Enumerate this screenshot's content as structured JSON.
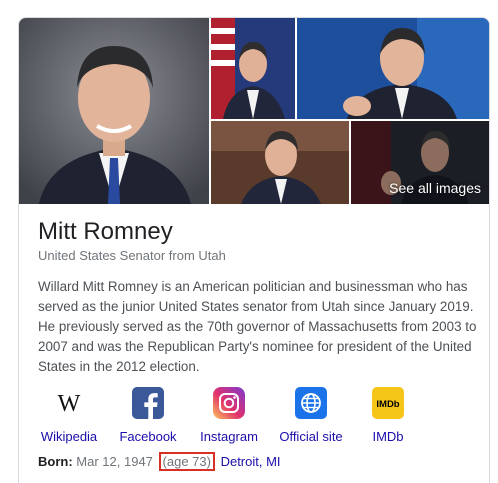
{
  "knowledge_panel": {
    "images": {
      "see_all_label": "See all images"
    },
    "name": "Mitt Romney",
    "subtitle": "United States Senator from Utah",
    "description": "Willard Mitt Romney is an American politician and businessman who has served as the junior United States senator from Utah since January 2019. He previously served as the 70th governor of Massachusetts from 2003 to 2007 and was the Republican Party's nominee for president of the United States in the 2012 election.",
    "profiles": [
      {
        "label": "Wikipedia",
        "icon": "wikipedia-icon",
        "color": "#ffffff"
      },
      {
        "label": "Facebook",
        "icon": "facebook-icon",
        "color": "#3b5998"
      },
      {
        "label": "Instagram",
        "icon": "instagram-icon",
        "color": "#c13584"
      },
      {
        "label": "Official site",
        "icon": "globe-icon",
        "color": "#1a73e8"
      },
      {
        "label": "IMDb",
        "icon": "imdb-icon",
        "color": "#f5c518"
      }
    ],
    "born": {
      "label": "Born:",
      "date": "Mar 12, 1947",
      "age": "(age 73)",
      "place": "Detroit, MI"
    },
    "colors": {
      "link": "#1a0dab",
      "highlight_box": "#d93025"
    }
  }
}
